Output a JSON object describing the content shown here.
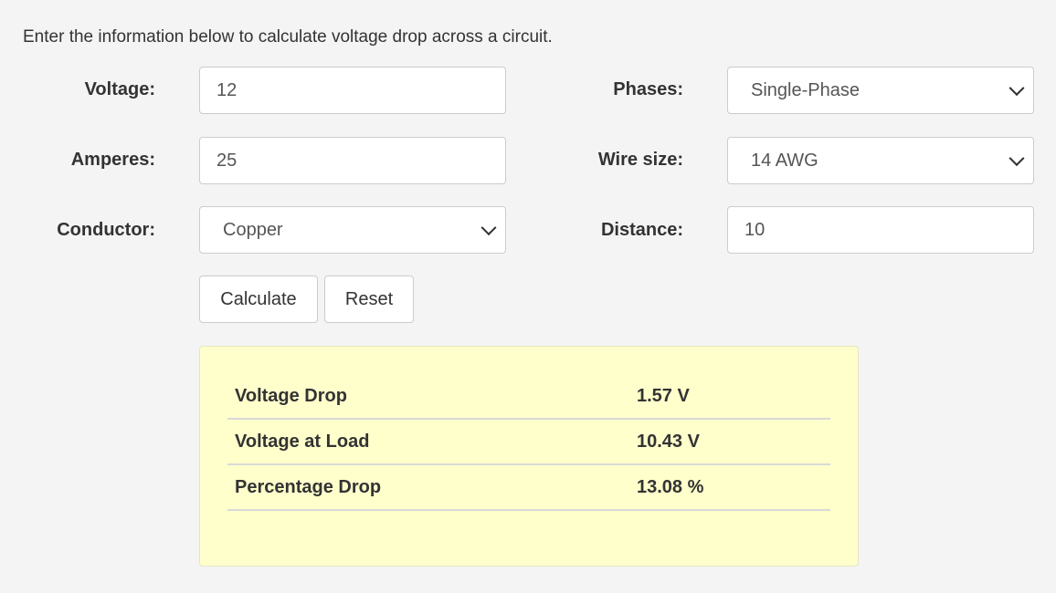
{
  "intro_text": "Enter the information below to calculate voltage drop across a circuit.",
  "form": {
    "voltage": {
      "label": "Voltage:",
      "value": "12"
    },
    "amperes": {
      "label": "Amperes:",
      "value": "25"
    },
    "conductor": {
      "label": "Conductor:",
      "selected": "Copper"
    },
    "phases": {
      "label": "Phases:",
      "selected": "Single-Phase"
    },
    "wire_size": {
      "label": "Wire size:",
      "selected": "14 AWG"
    },
    "distance": {
      "label": "Distance:",
      "value": "10"
    }
  },
  "buttons": {
    "calculate": "Calculate",
    "reset": "Reset"
  },
  "results": [
    {
      "label": "Voltage Drop",
      "value": "1.57 V"
    },
    {
      "label": "Voltage at Load",
      "value": "10.43 V"
    },
    {
      "label": "Percentage Drop",
      "value": "13.08 %"
    }
  ],
  "colors": {
    "background": "#f4f4f4",
    "results_background": "#ffffcc"
  }
}
